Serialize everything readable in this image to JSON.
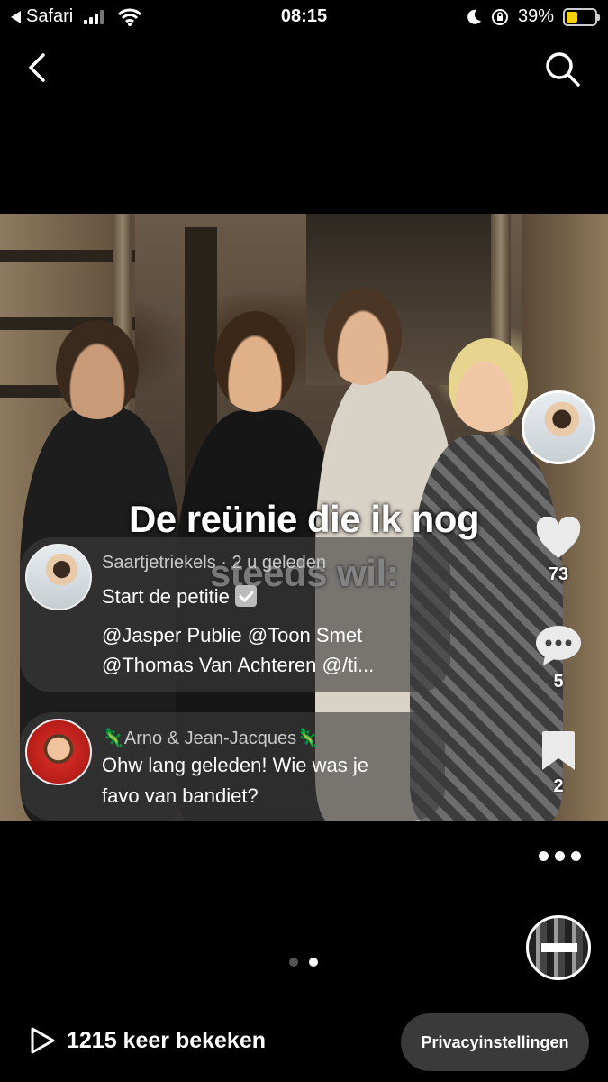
{
  "status_bar": {
    "back_app": "Safari",
    "time": "08:15",
    "battery": "39%",
    "battery_level": 0.39
  },
  "nav": {
    "back_icon": "chevron-left-icon",
    "search_icon": "search-icon"
  },
  "post": {
    "caption_line1": "De reünie die ik nog",
    "caption_line2": "steeds wil:"
  },
  "comments": [
    {
      "author": "Saartjetriekels · 2 u geleden",
      "title": "Start de petitie",
      "line1": "@Jasper Publie @Toon Smet",
      "line2": "@Thomas Van Achteren @/ti..."
    },
    {
      "author": "🦎Arno & Jean-Jacques🦎",
      "line1": "Ohw lang geleden! Wie was je",
      "line2": "favo van bandiet?"
    }
  ],
  "rail": {
    "likes": "73",
    "comments": "5",
    "saves": "2"
  },
  "pager": {
    "count": 2,
    "active": 2
  },
  "footer": {
    "views": "1215 keer bekeken",
    "privacy_button": "Privacyinstellingen"
  }
}
